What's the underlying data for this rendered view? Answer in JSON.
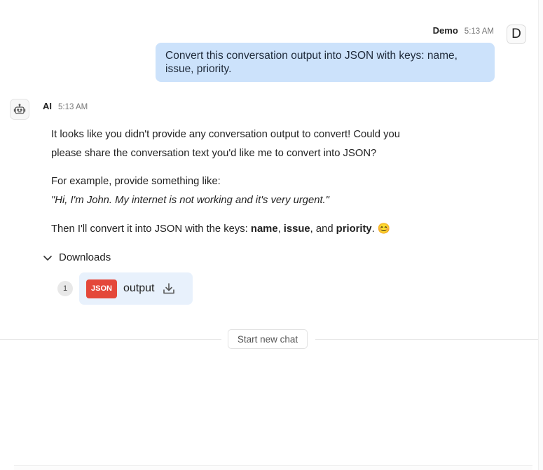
{
  "user_message": {
    "sender": "Demo",
    "time": "5:13 AM",
    "avatar_letter": "D",
    "text": "Convert this conversation output into JSON with keys: name, issue, priority."
  },
  "ai_message": {
    "sender": "AI",
    "time": "5:13 AM",
    "avatar_icon": "robot-icon",
    "paragraph1": "It looks like you didn't provide any conversation output to convert! Could you please share the conversation text you'd like me to convert into JSON?",
    "paragraph2_intro": "For example, provide something like:",
    "paragraph2_example": "\"Hi, I'm John. My internet is not working and it's very urgent.\"",
    "paragraph3": {
      "prefix": "Then I'll convert it into JSON with the keys: ",
      "key1": "name",
      "sep1": ", ",
      "key2": "issue",
      "sep2": ", and ",
      "key3": "priority",
      "suffix": ". 😊"
    }
  },
  "downloads": {
    "label": "Downloads",
    "expanded": true,
    "files": [
      {
        "index": "1",
        "badge": "JSON",
        "name": "output",
        "icon": "download-icon"
      }
    ]
  },
  "new_chat_label": "Start new chat",
  "colors": {
    "user_bubble": "#cce2fb",
    "file_card": "#e8f1fc",
    "json_badge": "#e4483a"
  }
}
